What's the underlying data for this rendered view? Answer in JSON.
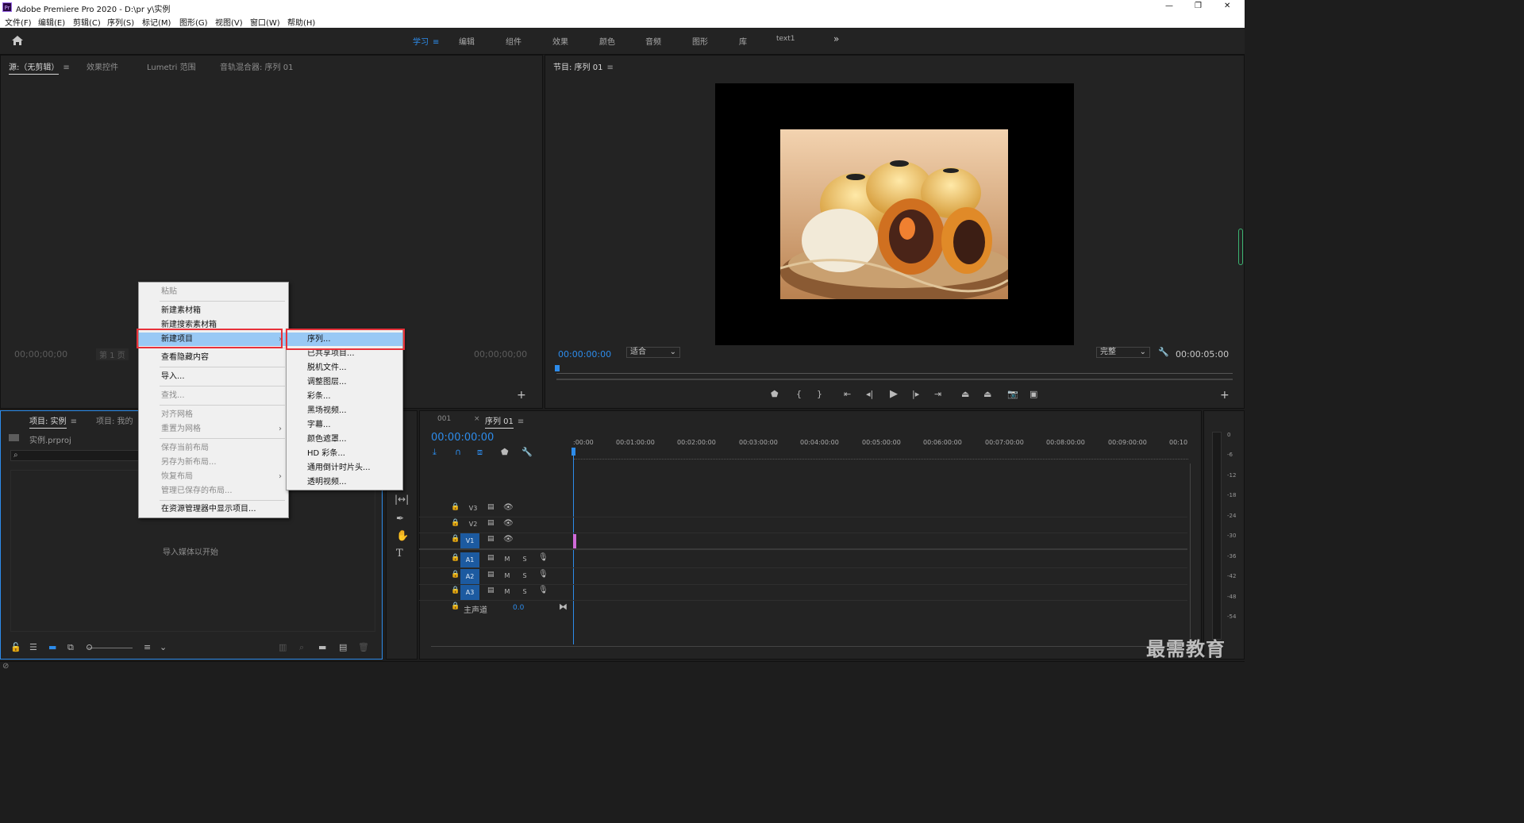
{
  "window": {
    "app_icon": "Pr",
    "title": "Adobe Premiere Pro 2020 - D:\\pr y\\实例",
    "minimize": "—",
    "restore": "❐",
    "close": "✕"
  },
  "menu": [
    "文件(F)",
    "编辑(E)",
    "剪辑(C)",
    "序列(S)",
    "标记(M)",
    "图形(G)",
    "视图(V)",
    "窗口(W)",
    "帮助(H)"
  ],
  "workspaces": {
    "items": [
      "学习",
      "编辑",
      "组件",
      "效果",
      "颜色",
      "音频",
      "图形",
      "库",
      "text1"
    ],
    "active": "学习",
    "more": "»"
  },
  "source_panel": {
    "tabs": [
      "源:（无剪辑）",
      "效果控件",
      "Lumetri 范围",
      "音轨混合器: 序列 01"
    ],
    "timecode_left": "00;00;00;00",
    "page": "第 1 页",
    "timecode_right": "00;00;00;00"
  },
  "program_panel": {
    "title": "节目: 序列 01",
    "timecode": "00:00:00:00",
    "fit": "适合",
    "quality": "完整",
    "duration": "00:00:05:00"
  },
  "project_panel": {
    "tabs": [
      "项目: 实例",
      "项目: 我的"
    ],
    "file": "实例.prproj",
    "empty_hint": "导入媒体以开始"
  },
  "context_menu": {
    "items": [
      {
        "label": "粘贴",
        "disabled": true
      },
      {
        "label": "新建素材箱",
        "disabled": false
      },
      {
        "label": "新建搜索素材箱",
        "disabled": false
      },
      {
        "label": "新建项目",
        "disabled": false,
        "submenu": true,
        "highlight": true
      },
      {
        "label": "查看隐藏内容",
        "disabled": false
      },
      {
        "label": "导入...",
        "disabled": false
      },
      {
        "label": "查找...",
        "disabled": true
      },
      {
        "label": "对齐网格",
        "disabled": true
      },
      {
        "label": "重置为网格",
        "disabled": true,
        "submenu": true
      },
      {
        "label": "保存当前布局",
        "disabled": true
      },
      {
        "label": "另存为新布局...",
        "disabled": true
      },
      {
        "label": "恢复布局",
        "disabled": true,
        "submenu": true
      },
      {
        "label": "管理已保存的布局...",
        "disabled": true
      },
      {
        "label": "在资源管理器中显示项目...",
        "disabled": false
      }
    ]
  },
  "submenu": {
    "items": [
      "序列...",
      "已共享项目...",
      "脱机文件...",
      "调整图层...",
      "彩条...",
      "黑场视频...",
      "字幕...",
      "颜色遮罩...",
      "HD 彩条...",
      "通用倒计时片头...",
      "透明视频..."
    ],
    "highlight": "序列..."
  },
  "timeline": {
    "tabs": [
      "001",
      "序列 01"
    ],
    "timecode": "00:00:00:00",
    "ruler": [
      ":00:00",
      "00:01:00:00",
      "00:02:00:00",
      "00:03:00:00",
      "00:04:00:00",
      "00:05:00:00",
      "00:06:00:00",
      "00:07:00:00",
      "00:08:00:00",
      "00:09:00:00",
      "00:10"
    ],
    "video_tracks": [
      "V3",
      "V2",
      "V1"
    ],
    "audio_tracks": [
      "A1",
      "A2",
      "A3"
    ],
    "m": "M",
    "s": "S",
    "master": "主声道",
    "master_value": "0.0"
  },
  "meter_labels": [
    "0",
    "-6",
    "-12",
    "-18",
    "-24",
    "-30",
    "-36",
    "-42",
    "-48",
    "-54"
  ],
  "watermark": "最需教育",
  "colors": {
    "accent": "#2d8ceb",
    "highlight": "#99c9f5",
    "redbox": "#e8313a",
    "target": "#1c5aa0"
  }
}
